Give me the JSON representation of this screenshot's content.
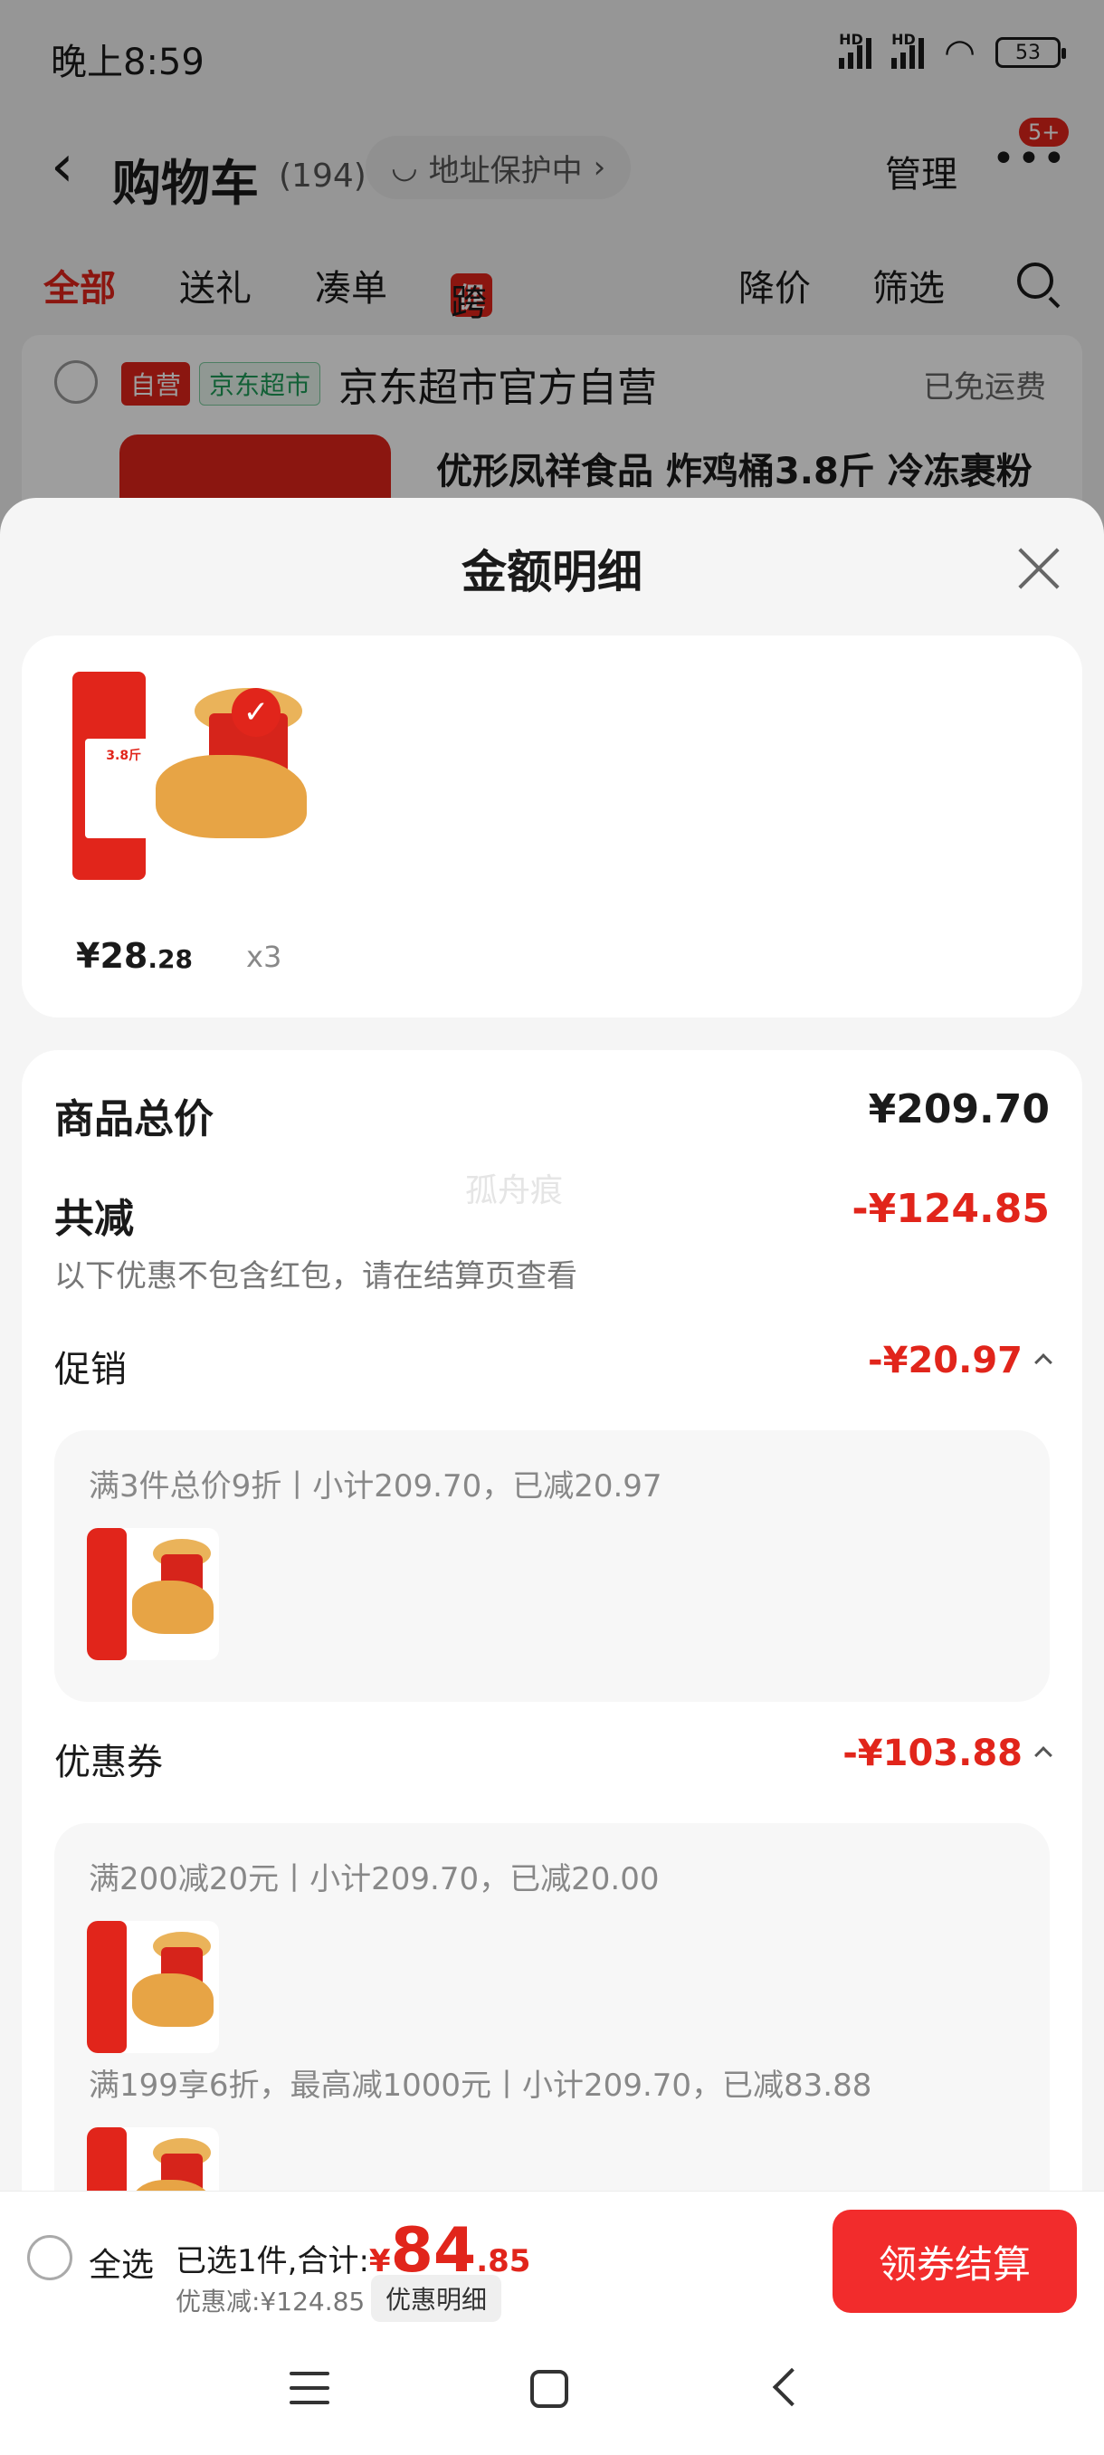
{
  "status_bar": {
    "time": "晚上8:59",
    "hd1": "HD",
    "hd2": "HD",
    "battery": "53"
  },
  "cart_header": {
    "back_icon": "chevron-left-icon",
    "title": "购物车",
    "count": "(194)",
    "address_protect": "地址保护中",
    "manage": "管理",
    "more_badge": "5+"
  },
  "tabs": [
    {
      "label": "全部"
    },
    {
      "label": "送礼"
    },
    {
      "label": "凑单"
    },
    {
      "label": "跨店满减",
      "tag": "促"
    },
    {
      "label": "降价"
    },
    {
      "label": "筛选"
    }
  ],
  "shop": {
    "tag_self": "自营",
    "tag_super": "京东超市",
    "name": "京东超市官方自营",
    "free_shipping": "已免运费",
    "product_name": "优形凤祥食品 炸鸡桶3.8斤 冷冻裹粉"
  },
  "sheet": {
    "title": "金额明细",
    "item": {
      "price_int": "¥28",
      "price_dec": ".28",
      "qty": "x3",
      "img_text": "3.8斤"
    },
    "total_label": "商品总价",
    "total_value": "¥209.70",
    "watermark": "孤舟痕",
    "reduce_label": "共减",
    "reduce_value": "-¥124.85",
    "reduce_note": "以下优惠不包含红包，请在结算页查看",
    "promo_label": "促销",
    "promo_value": "-¥20.97",
    "promo_lines": [
      "满3件总价9折丨小计209.70，已减20.97"
    ],
    "coupon_label": "优惠券",
    "coupon_value": "-¥103.88",
    "coupon_lines": [
      "满200减20元丨小计209.70，已减20.00",
      "满199享6折，最高减1000元丨小计209.70，已减83.88"
    ]
  },
  "bottom_bar": {
    "select_all": "全选",
    "summary_prefix": "已选1件,合计:",
    "yen": "¥",
    "total_int": "84",
    "total_dec": ".85",
    "discount": "优惠减:¥124.85",
    "detail_button": "优惠明细",
    "checkout": "领券结算"
  },
  "colors": {
    "accent": "#e1251b",
    "checkout": "#f22c2c",
    "green_tag": "#1e9b57"
  }
}
